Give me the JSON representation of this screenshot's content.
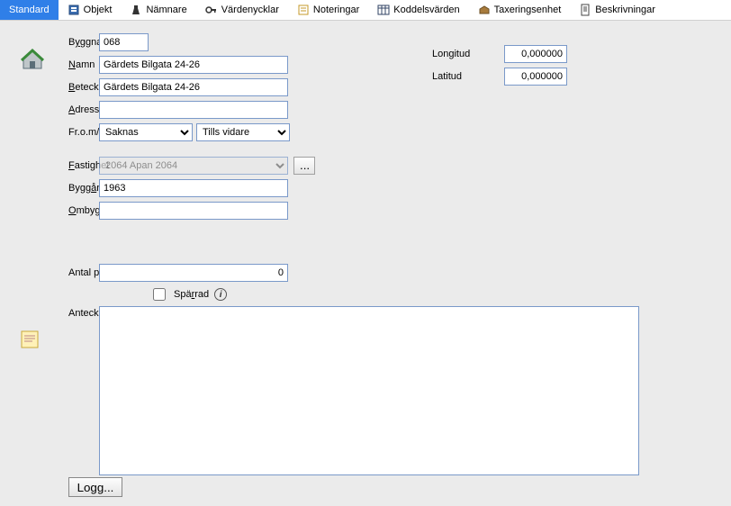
{
  "tabs": {
    "standard": "Standard",
    "objekt": "Objekt",
    "namnare": "Nämnare",
    "vardenycklar": "Värdenycklar",
    "noteringar": "Noteringar",
    "koddelsvarden": "Koddelsvärden",
    "taxeringsenhet": "Taxeringsenhet",
    "beskrivningar": "Beskrivningar"
  },
  "labels": {
    "byggnad": "Byggnad",
    "namn": "Namn",
    "beteckning": "Beteckning",
    "adress": "Adress",
    "from_tom": "Fr.o.m/t.o.m",
    "fastighet": "Fastighet",
    "byggar": "Byggår",
    "ombyggnadsar": "Ombyggnadsår",
    "antal_plan": "Antal plan",
    "sparrad": "Spärrad",
    "anteckning": "Anteckning",
    "longitud": "Longitud",
    "latitud": "Latitud",
    "logg_btn": "Logg..."
  },
  "values": {
    "byggnad": "068",
    "namn": "Gärdets Bilgata 24-26",
    "beteckning": "Gärdets Bilgata 24-26",
    "adress": "",
    "from_sel": "Saknas",
    "tom_sel": "Tills vidare",
    "fastighet": "2064 Apan 2064",
    "byggar": "1963",
    "ombyggnadsar": "",
    "antal_plan": "0",
    "sparrad_checked": false,
    "anteckning": "",
    "longitud": "0,000000",
    "latitud": "0,000000"
  }
}
